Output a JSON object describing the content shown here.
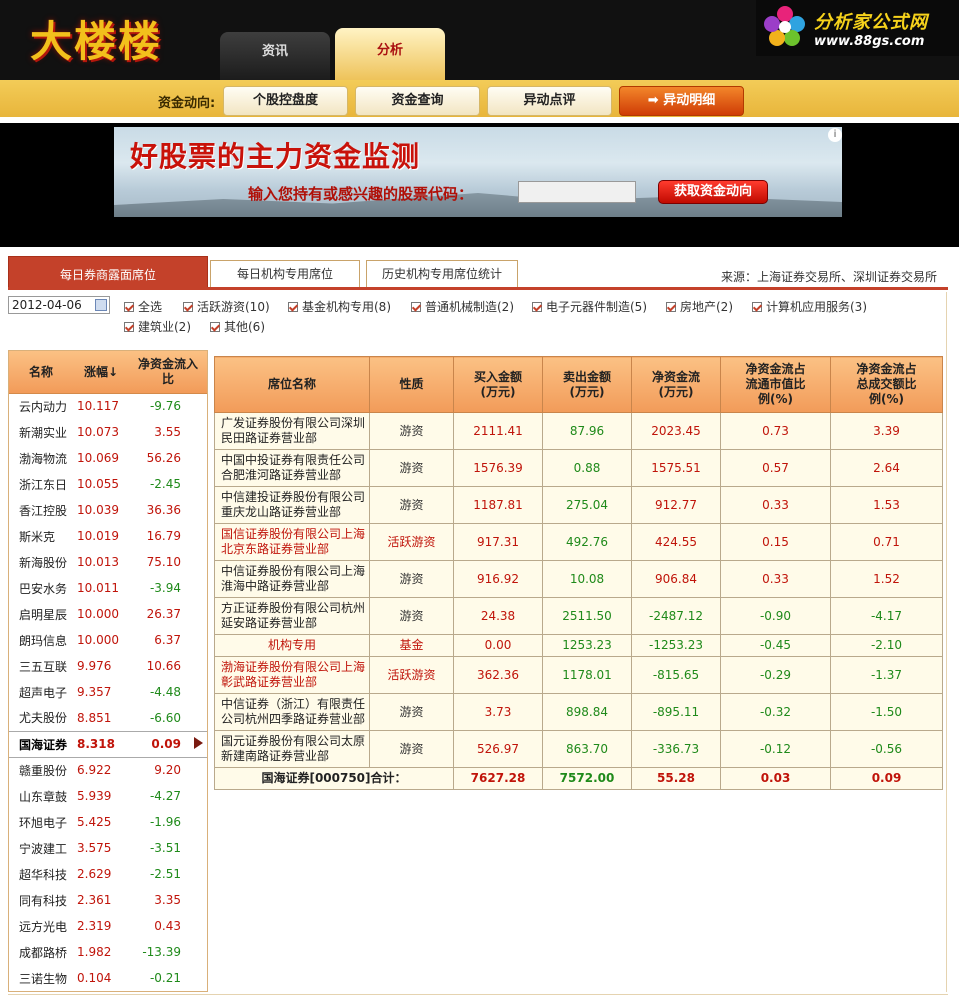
{
  "header": {
    "logo_text": "大楼楼",
    "main_tabs": [
      {
        "label": "资讯"
      },
      {
        "label": "分析"
      }
    ],
    "brand_name": "分析家公式网",
    "brand_url": "www.88gs.com"
  },
  "subnav": {
    "label": "资金动向:",
    "buttons": [
      {
        "label": "个股控盘度"
      },
      {
        "label": "资金查询"
      },
      {
        "label": "异动点评"
      },
      {
        "label": "➡ 异动明细"
      }
    ]
  },
  "banner": {
    "title": "好股票的主力资金监测",
    "prompt": "输入您持有或感兴趣的股票代码：",
    "button": "获取资金动向",
    "ad_info": "i"
  },
  "tabs": [
    {
      "label": "每日券商露面席位"
    },
    {
      "label": "每日机构专用席位"
    },
    {
      "label": "历史机构专用席位统计"
    }
  ],
  "source": "来源：上海证券交易所、深圳证券交易所",
  "date": "2012-04-06",
  "filters": [
    {
      "label": "全选"
    },
    {
      "label": "活跃游资(10)"
    },
    {
      "label": "基金机构专用(8)"
    },
    {
      "label": "普通机械制造(2)"
    },
    {
      "label": "电子元器件制造(5)"
    },
    {
      "label": "房地产(2)"
    },
    {
      "label": "计算机应用服务(3)"
    },
    {
      "label": "建筑业(2)"
    },
    {
      "label": "其他(6)"
    }
  ],
  "stock_table": {
    "headers": {
      "name": "名称",
      "change": "涨幅↓",
      "netflow": "净资金流入比"
    },
    "rows": [
      {
        "name": "云内动力",
        "change": "10.117",
        "netflow": "-9.76"
      },
      {
        "name": "新潮实业",
        "change": "10.073",
        "netflow": "3.55"
      },
      {
        "name": "渤海物流",
        "change": "10.069",
        "netflow": "56.26"
      },
      {
        "name": "浙江东日",
        "change": "10.055",
        "netflow": "-2.45"
      },
      {
        "name": "香江控股",
        "change": "10.039",
        "netflow": "36.36"
      },
      {
        "name": "斯米克",
        "change": "10.019",
        "netflow": "16.79"
      },
      {
        "name": "新海股份",
        "change": "10.013",
        "netflow": "75.10"
      },
      {
        "name": "巴安水务",
        "change": "10.011",
        "netflow": "-3.94"
      },
      {
        "name": "启明星辰",
        "change": "10.000",
        "netflow": "26.37"
      },
      {
        "name": "朗玛信息",
        "change": "10.000",
        "netflow": "6.37"
      },
      {
        "name": "三五互联",
        "change": "9.976",
        "netflow": "10.66"
      },
      {
        "name": "超声电子",
        "change": "9.357",
        "netflow": "-4.48"
      },
      {
        "name": "尤夫股份",
        "change": "8.851",
        "netflow": "-6.60"
      },
      {
        "name": "国海证券",
        "change": "8.318",
        "netflow": "0.09"
      },
      {
        "name": "赣重股份",
        "change": "6.922",
        "netflow": "9.20"
      },
      {
        "name": "山东章鼓",
        "change": "5.939",
        "netflow": "-4.27"
      },
      {
        "name": "环旭电子",
        "change": "5.425",
        "netflow": "-1.96"
      },
      {
        "name": "宁波建工",
        "change": "3.575",
        "netflow": "-3.51"
      },
      {
        "name": "超华科技",
        "change": "2.629",
        "netflow": "-2.51"
      },
      {
        "name": "同有科技",
        "change": "2.361",
        "netflow": "3.35"
      },
      {
        "name": "远方光电",
        "change": "2.319",
        "netflow": "0.43"
      },
      {
        "name": "成都路桥",
        "change": "1.982",
        "netflow": "-13.39"
      },
      {
        "name": "三诺生物",
        "change": "0.104",
        "netflow": "-0.21"
      }
    ]
  },
  "seat_table": {
    "headers": {
      "seat": "席位名称",
      "type": "性质",
      "buy": "买入金额(万元)",
      "sell": "卖出金额(万元)",
      "net": "净资金流(万元)",
      "mv_ratio": "净资金流占流通市值比例(%)",
      "vol_ratio": "净资金流占总成交额比例(%)"
    },
    "rows": [
      {
        "seat": "广发证券股份有限公司深圳民田路证券营业部",
        "type": "游资",
        "buy": "2111.41",
        "sell": "87.96",
        "net": "2023.45",
        "mv_ratio": "0.73",
        "vol_ratio": "3.39"
      },
      {
        "seat": "中国中投证券有限责任公司合肥淮河路证券营业部",
        "type": "游资",
        "buy": "1576.39",
        "sell": "0.88",
        "net": "1575.51",
        "mv_ratio": "0.57",
        "vol_ratio": "2.64"
      },
      {
        "seat": "中信建投证券股份有限公司重庆龙山路证券营业部",
        "type": "游资",
        "buy": "1187.81",
        "sell": "275.04",
        "net": "912.77",
        "mv_ratio": "0.33",
        "vol_ratio": "1.53"
      },
      {
        "seat": "国信证券股份有限公司上海北京东路证券营业部",
        "type": "活跃游资",
        "buy": "917.31",
        "sell": "492.76",
        "net": "424.55",
        "mv_ratio": "0.15",
        "vol_ratio": "0.71"
      },
      {
        "seat": "中信证券股份有限公司上海淮海中路证券营业部",
        "type": "游资",
        "buy": "916.92",
        "sell": "10.08",
        "net": "906.84",
        "mv_ratio": "0.33",
        "vol_ratio": "1.52"
      },
      {
        "seat": "方正证券股份有限公司杭州延安路证券营业部",
        "type": "游资",
        "buy": "24.38",
        "sell": "2511.50",
        "net": "-2487.12",
        "mv_ratio": "-0.90",
        "vol_ratio": "-4.17"
      },
      {
        "seat": "机构专用",
        "type": "基金",
        "buy": "0.00",
        "sell": "1253.23",
        "net": "-1253.23",
        "mv_ratio": "-0.45",
        "vol_ratio": "-2.10"
      },
      {
        "seat": "渤海证券股份有限公司上海彰武路证券营业部",
        "type": "活跃游资",
        "buy": "362.36",
        "sell": "1178.01",
        "net": "-815.65",
        "mv_ratio": "-0.29",
        "vol_ratio": "-1.37"
      },
      {
        "seat": "中信证券（浙江）有限责任公司杭州四季路证券营业部",
        "type": "游资",
        "buy": "3.73",
        "sell": "898.84",
        "net": "-895.11",
        "mv_ratio": "-0.32",
        "vol_ratio": "-1.50"
      },
      {
        "seat": "国元证券股份有限公司太原新建南路证券营业部",
        "type": "游资",
        "buy": "526.97",
        "sell": "863.70",
        "net": "-336.73",
        "mv_ratio": "-0.12",
        "vol_ratio": "-0.56"
      }
    ],
    "total": {
      "label": "国海证券[000750]合计：",
      "buy": "7627.28",
      "sell": "7572.00",
      "net": "55.28",
      "mv_ratio": "0.03",
      "vol_ratio": "0.09"
    }
  },
  "colors": {
    "accent": "#c4412a",
    "up": "#c0140a",
    "down": "#1f8a1a",
    "header_gold": "#f3cc58"
  }
}
